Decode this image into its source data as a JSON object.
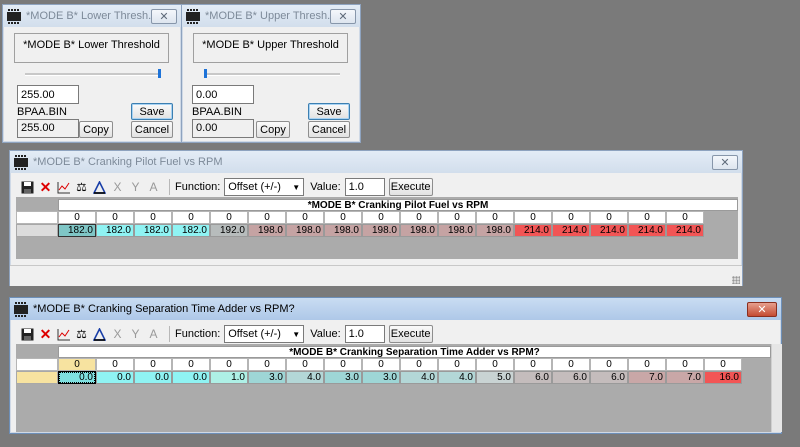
{
  "dialogs": [
    {
      "title": "*MODE B* Lower Thresh...",
      "group_label": "*MODE B* Lower Threshold",
      "value": "255.00",
      "file": "BPAA.BIN",
      "file_value": "255.00",
      "save_label": "Save",
      "copy_label": "Copy",
      "cancel_label": "Cancel",
      "slider_fraction": 1.0
    },
    {
      "title": "*MODE B* Upper Thresh...",
      "group_label": "*MODE B* Upper Threshold",
      "value": "0.00",
      "file": "BPAA.BIN",
      "file_value": "0.00",
      "save_label": "Save",
      "copy_label": "Copy",
      "cancel_label": "Cancel",
      "slider_fraction": 0.0
    }
  ],
  "tables": [
    {
      "title": "*MODE B* Cranking Pilot Fuel vs RPM",
      "function_label": "Function:",
      "function_value": "Offset (+/-)",
      "value_label": "Value:",
      "value": "1.0",
      "execute_label": "Execute",
      "table_title": "*MODE B* Cranking Pilot Fuel vs RPM",
      "headers": [
        "0",
        "0",
        "0",
        "0",
        "0",
        "0",
        "0",
        "0",
        "0",
        "0",
        "0",
        "0",
        "0",
        "0",
        "0",
        "0",
        "0"
      ],
      "values": [
        "182.0",
        "182.0",
        "182.0",
        "182.0",
        "192.0",
        "198.0",
        "198.0",
        "198.0",
        "198.0",
        "198.0",
        "198.0",
        "198.0",
        "214.0",
        "214.0",
        "214.0",
        "214.0",
        "214.0"
      ],
      "colors": [
        "#7fc6c6",
        "#8ff3f3",
        "#8ff3f3",
        "#8ff3f3",
        "#b7bcbc",
        "#c5a3a3",
        "#c5a3a3",
        "#c5a3a3",
        "#c5a3a3",
        "#c5a3a3",
        "#c5a3a3",
        "#c5a3a3",
        "#f25555",
        "#f25555",
        "#f25555",
        "#f25555",
        "#f25555"
      ]
    },
    {
      "title": "*MODE B* Cranking Separation Time Adder vs RPM?",
      "function_label": "Function:",
      "function_value": "Offset (+/-)",
      "value_label": "Value:",
      "value": "1.0",
      "execute_label": "Execute",
      "table_title": "*MODE B* Cranking Separation Time Adder vs RPM?",
      "headers": [
        "0",
        "0",
        "0",
        "0",
        "0",
        "0",
        "0",
        "0",
        "0",
        "0",
        "0",
        "0",
        "0",
        "0",
        "0",
        "0",
        "0",
        "0"
      ],
      "values": [
        "0.0",
        "0.0",
        "0.0",
        "0.0",
        "1.0",
        "3.0",
        "4.0",
        "3.0",
        "3.0",
        "4.0",
        "4.0",
        "5.0",
        "6.0",
        "6.0",
        "6.0",
        "7.0",
        "7.0",
        "16.0"
      ],
      "colors": [
        "#8ff3f3",
        "#8ff3f3",
        "#8ff3f3",
        "#8ff3f3",
        "#aef0e6",
        "#9ed6d6",
        "#b3d7d7",
        "#9ed6d6",
        "#9ed6d6",
        "#b3d7d7",
        "#b3d7d7",
        "#c9d3d3",
        "#c4bcbc",
        "#c4bcbc",
        "#c4bcbc",
        "#c9a7a7",
        "#c9a7a7",
        "#f25555"
      ]
    }
  ]
}
